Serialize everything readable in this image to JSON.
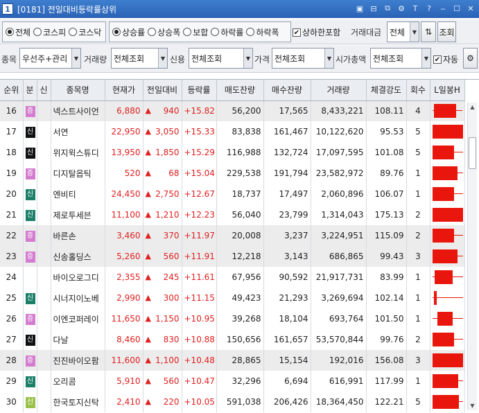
{
  "window": {
    "number": "1",
    "title": "[0181] 전일대비등락률상위",
    "icons": [
      "multi-window-icon",
      "link-icon",
      "popout-icon",
      "settings-icon",
      "font-icon",
      "help-icon",
      "minimize-icon",
      "maximize-icon",
      "close-icon"
    ]
  },
  "filters": {
    "market": {
      "options": [
        "전체",
        "코스피",
        "코스닥"
      ],
      "selected": "전체"
    },
    "direction": {
      "options": [
        "상승률",
        "상승폭",
        "보합",
        "하락률",
        "하락폭"
      ],
      "selected": "상승률"
    },
    "include_limit": {
      "label": "상하한포함",
      "checked": true
    },
    "trade_amount": {
      "label": "거래대금",
      "value": "전체"
    },
    "search_button": "조회",
    "stock_type": {
      "label": "종목",
      "value": "우선주+관리"
    },
    "volume": {
      "label": "거래량",
      "value": "전체조회"
    },
    "credit": {
      "label": "신용",
      "value": "전체조회"
    },
    "price": {
      "label": "가격",
      "value": "전체조회"
    },
    "market_cap": {
      "label": "시가총액",
      "value": "전체조회"
    },
    "auto": {
      "label": "자동",
      "checked": true
    }
  },
  "table": {
    "columns": [
      "순위",
      "분",
      "신",
      "종목명",
      "현재가",
      "전일대비",
      "등락률",
      "매도잔량",
      "매수잔량",
      "거래량",
      "체결강도",
      "회수",
      "L일봉H"
    ],
    "rows": [
      {
        "rank": "16",
        "badge": "증",
        "badge_style": "p",
        "name": "넥스트사이언",
        "price": "6,880",
        "change": "940",
        "rate": "+15.82",
        "ask": "56,200",
        "bid": "17,565",
        "volume": "8,433,221",
        "strength": "108.11",
        "count": "4",
        "candle": {
          "low": 0.02,
          "open": 0.05,
          "close": 0.78,
          "high": 1.0
        },
        "shade": true
      },
      {
        "rank": "17",
        "badge": "신",
        "badge_style": "k",
        "name": "서연",
        "price": "22,950",
        "change": "3,050",
        "rate": "+15.33",
        "ask": "83,838",
        "bid": "161,467",
        "volume": "10,122,620",
        "strength": "95.53",
        "count": "5",
        "candle": {
          "low": 0.0,
          "open": 0.0,
          "close": 1.0,
          "high": 1.0
        },
        "shade": false
      },
      {
        "rank": "18",
        "badge": "신",
        "badge_style": "k",
        "name": "위지윅스튜디",
        "price": "13,950",
        "change": "1,850",
        "rate": "+15.29",
        "ask": "116,988",
        "bid": "132,724",
        "volume": "17,097,595",
        "strength": "101.08",
        "count": "5",
        "candle": {
          "low": 0.0,
          "open": 0.0,
          "close": 0.72,
          "high": 1.0
        },
        "shade": false
      },
      {
        "rank": "19",
        "badge": "증",
        "badge_style": "p",
        "name": "디지탈옵틱",
        "price": "520",
        "change": "68",
        "rate": "+15.04",
        "ask": "229,538",
        "bid": "191,794",
        "volume": "23,582,972",
        "strength": "89.76",
        "count": "1",
        "candle": {
          "low": 0.0,
          "open": 0.0,
          "close": 0.82,
          "high": 1.0
        },
        "shade": false
      },
      {
        "rank": "20",
        "badge": "신",
        "badge_style": "s",
        "name": "엔비티",
        "price": "24,450",
        "change": "2,750",
        "rate": "+12.67",
        "ask": "18,737",
        "bid": "17,497",
        "volume": "2,060,896",
        "strength": "106.07",
        "count": "1",
        "candle": {
          "low": 0.0,
          "open": 0.0,
          "close": 0.72,
          "high": 1.0
        },
        "shade": false
      },
      {
        "rank": "21",
        "badge": "신",
        "badge_style": "s",
        "name": "제로투세븐",
        "price": "11,100",
        "change": "1,210",
        "rate": "+12.23",
        "ask": "56,040",
        "bid": "23,799",
        "volume": "1,314,043",
        "strength": "175.13",
        "count": "2",
        "candle": {
          "low": 0.0,
          "open": 0.0,
          "close": 1.0,
          "high": 1.0
        },
        "shade": false
      },
      {
        "rank": "22",
        "badge": "증",
        "badge_style": "p",
        "name": "바른손",
        "price": "3,460",
        "change": "370",
        "rate": "+11.97",
        "ask": "20,008",
        "bid": "3,237",
        "volume": "3,224,951",
        "strength": "115.09",
        "count": "2",
        "candle": {
          "low": 0.0,
          "open": 0.0,
          "close": 0.72,
          "high": 1.0
        },
        "shade": true
      },
      {
        "rank": "23",
        "badge": "증",
        "badge_style": "p",
        "name": "신송홀딩스",
        "price": "5,260",
        "change": "560",
        "rate": "+11.91",
        "ask": "12,218",
        "bid": "3,143",
        "volume": "686,865",
        "strength": "99.43",
        "count": "3",
        "candle": {
          "low": 0.0,
          "open": 0.0,
          "close": 0.82,
          "high": 1.0
        },
        "shade": true
      },
      {
        "rank": "24",
        "badge": "",
        "badge_style": "",
        "name": "바이오로그디",
        "price": "2,355",
        "change": "245",
        "rate": "+11.61",
        "ask": "67,956",
        "bid": "90,592",
        "volume": "21,917,731",
        "strength": "83.99",
        "count": "1",
        "candle": {
          "low": 0.0,
          "open": 0.07,
          "close": 0.66,
          "high": 1.0
        },
        "shade": false
      },
      {
        "rank": "25",
        "badge": "신",
        "badge_style": "s",
        "name": "시너지이노베",
        "price": "2,990",
        "change": "300",
        "rate": "+11.15",
        "ask": "49,423",
        "bid": "21,293",
        "volume": "3,269,694",
        "strength": "102.14",
        "count": "1",
        "candle": {
          "low": 0.0,
          "open": 0.06,
          "close": 0.15,
          "high": 1.0
        },
        "shade": false
      },
      {
        "rank": "26",
        "badge": "증",
        "badge_style": "p",
        "name": "이엔코퍼레이",
        "price": "11,650",
        "change": "1,150",
        "rate": "+10.95",
        "ask": "39,268",
        "bid": "18,104",
        "volume": "693,764",
        "strength": "101.50",
        "count": "1",
        "candle": {
          "low": 0.0,
          "open": 0.18,
          "close": 0.68,
          "high": 1.0
        },
        "shade": false
      },
      {
        "rank": "27",
        "badge": "신",
        "badge_style": "k",
        "name": "다날",
        "price": "8,460",
        "change": "830",
        "rate": "+10.88",
        "ask": "150,656",
        "bid": "161,657",
        "volume": "53,570,844",
        "strength": "99.76",
        "count": "2",
        "candle": {
          "low": 0.0,
          "open": 0.0,
          "close": 0.72,
          "high": 1.0
        },
        "shade": false
      },
      {
        "rank": "28",
        "badge": "증",
        "badge_style": "p",
        "name": "진진바이오팜",
        "price": "11,600",
        "change": "1,100",
        "rate": "+10.48",
        "ask": "28,865",
        "bid": "15,154",
        "volume": "192,016",
        "strength": "156.08",
        "count": "3",
        "candle": {
          "low": 0.0,
          "open": 0.0,
          "close": 1.0,
          "high": 1.0
        },
        "shade": true
      },
      {
        "rank": "29",
        "badge": "신",
        "badge_style": "s",
        "name": "오리콤",
        "price": "5,910",
        "change": "560",
        "rate": "+10.47",
        "ask": "32,296",
        "bid": "6,694",
        "volume": "616,991",
        "strength": "117.99",
        "count": "1",
        "candle": {
          "low": 0.0,
          "open": 0.0,
          "close": 0.86,
          "high": 1.0
        },
        "shade": false
      },
      {
        "rank": "30",
        "badge": "신",
        "badge_style": "y",
        "name": "한국토지신탁",
        "price": "2,410",
        "change": "220",
        "rate": "+10.05",
        "ask": "591,038",
        "bid": "206,426",
        "volume": "18,364,450",
        "strength": "122.21",
        "count": "5",
        "candle": {
          "low": 0.0,
          "open": 0.0,
          "close": 0.88,
          "high": 1.0
        },
        "shade": false
      }
    ]
  },
  "colors": {
    "up": "#e02020",
    "candle": "#e8160c",
    "title_bar": "#2a62b5"
  }
}
